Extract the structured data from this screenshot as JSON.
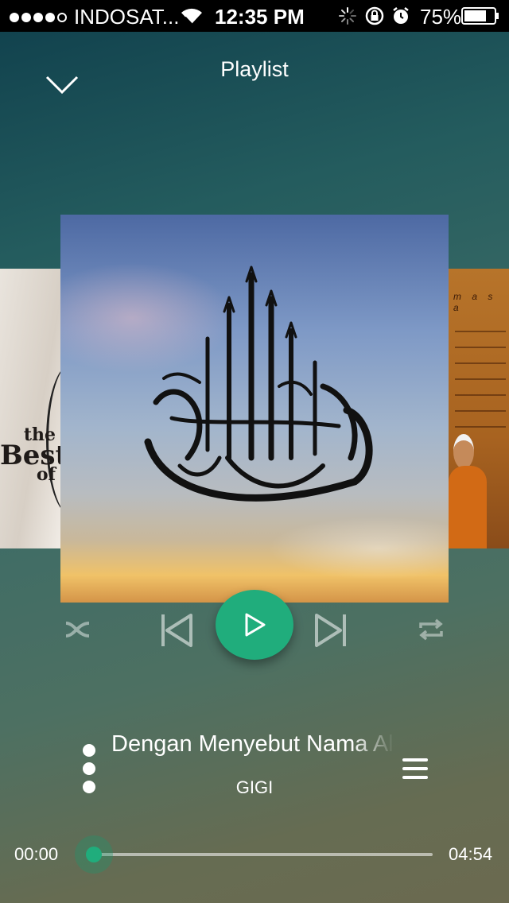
{
  "status_bar": {
    "carrier": "INDOSAT...",
    "time": "12:35 PM",
    "battery_percent": "75%",
    "battery_level": 0.75,
    "signal_strength": 4
  },
  "header": {
    "title": "Playlist"
  },
  "albums": {
    "previous_cover_text": [
      "the",
      "Best",
      "of"
    ],
    "next_cover_text": "m a s a"
  },
  "now_playing": {
    "title": "Dengan Menyebut Nama Allah",
    "artist": "GIGI",
    "current_time": "00:00",
    "total_time": "04:54",
    "progress": 0.0
  },
  "colors": {
    "accent": "#20ad7c",
    "status_bar_bg": "#000000"
  },
  "icons": {
    "collapse": "chevron-down-icon",
    "shuffle": "shuffle-icon",
    "previous": "skip-previous-icon",
    "play": "play-icon",
    "next": "skip-next-icon",
    "repeat": "repeat-icon",
    "more": "more-vertical-icon",
    "queue": "queue-list-icon"
  }
}
